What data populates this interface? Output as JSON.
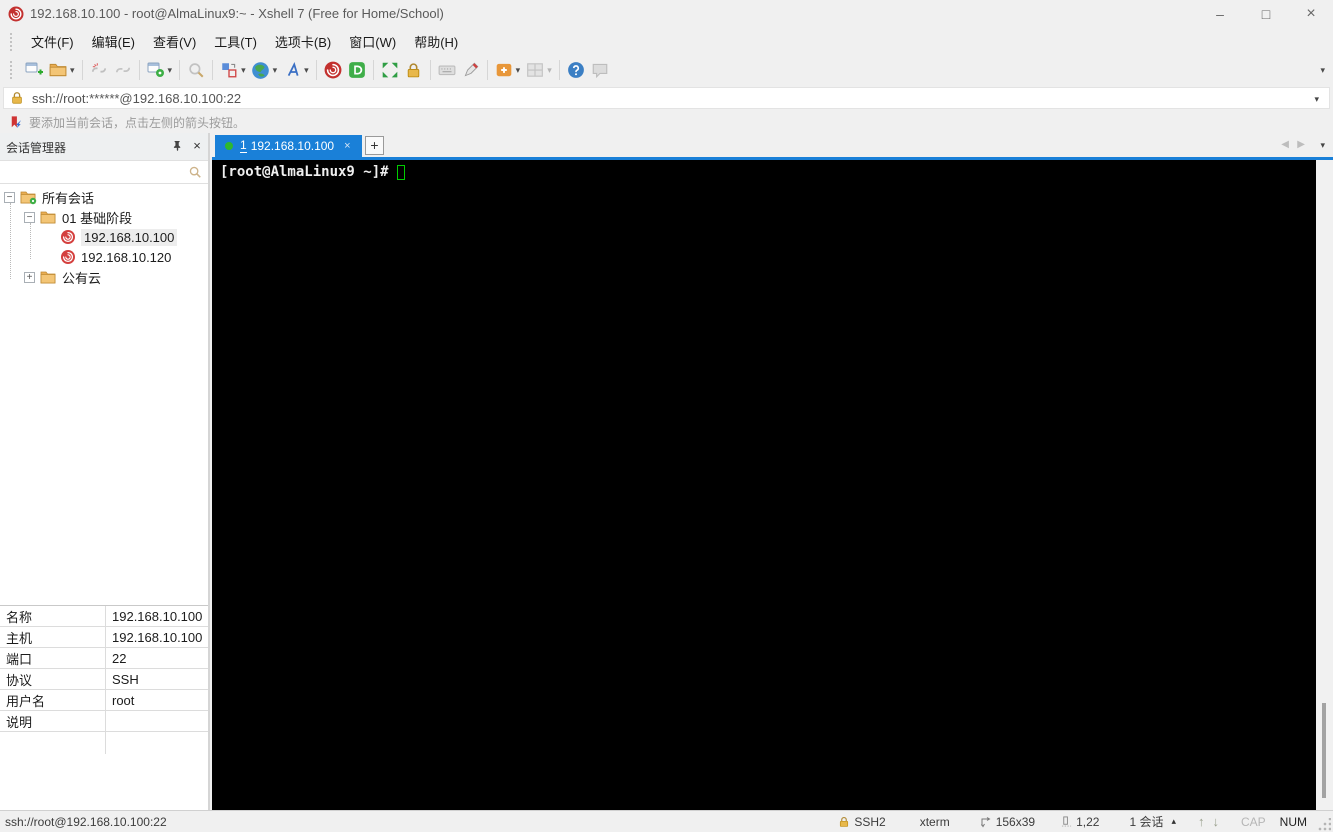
{
  "window": {
    "title": "192.168.10.100 - root@AlmaLinux9:~ - Xshell 7 (Free for Home/School)"
  },
  "glyphs": {
    "minimize": "–",
    "maximize": "□",
    "close": "×",
    "caret_down": "▾",
    "plus": "+",
    "minus": "−",
    "arrow_left": "◀",
    "arrow_right": "▶",
    "triangle_up": "▴",
    "arrow_up": "↑",
    "arrow_down": "↓"
  },
  "menu": {
    "items": [
      "文件(F)",
      "编辑(E)",
      "查看(V)",
      "工具(T)",
      "选项卡(B)",
      "窗口(W)",
      "帮助(H)"
    ]
  },
  "icons": {
    "toolbar": [
      "new-session",
      "open-folder",
      "disconnect",
      "reconnect",
      "session-properties",
      "find",
      "compose-pane",
      "encoding-globe",
      "font",
      "xshell",
      "xftp",
      "fullscreen",
      "lock",
      "virtual-keyboard",
      "highlight",
      "new-file",
      "layout",
      "help",
      "feedback"
    ]
  },
  "address": {
    "value": "ssh://root:******@192.168.10.100:22"
  },
  "infobar": {
    "text": "要添加当前会话，点击左侧的箭头按钮。"
  },
  "session_manager": {
    "title": "会话管理器",
    "search_value": "",
    "tree": {
      "root": "所有会话",
      "folder1": "01 基础阶段",
      "session1": "192.168.10.100",
      "session2": "192.168.10.120",
      "folder2": "公有云"
    }
  },
  "properties": {
    "rows": [
      {
        "label": "名称",
        "value": "192.168.10.100"
      },
      {
        "label": "主机",
        "value": "192.168.10.100"
      },
      {
        "label": "端口",
        "value": "22"
      },
      {
        "label": "协议",
        "value": "SSH"
      },
      {
        "label": "用户名",
        "value": "root"
      },
      {
        "label": "说明",
        "value": ""
      }
    ]
  },
  "tabs": {
    "active": {
      "number": "1",
      "label": "192.168.10.100"
    }
  },
  "terminal": {
    "prompt": "[root@AlmaLinux9 ~]#"
  },
  "statusbar": {
    "connection": "ssh://root@192.168.10.100:22",
    "protocol": "SSH2",
    "terminal_type": "xterm",
    "size": "156x39",
    "cursor_position": "1,22",
    "session_count": "1 会话",
    "cap": "CAP",
    "num": "NUM"
  }
}
